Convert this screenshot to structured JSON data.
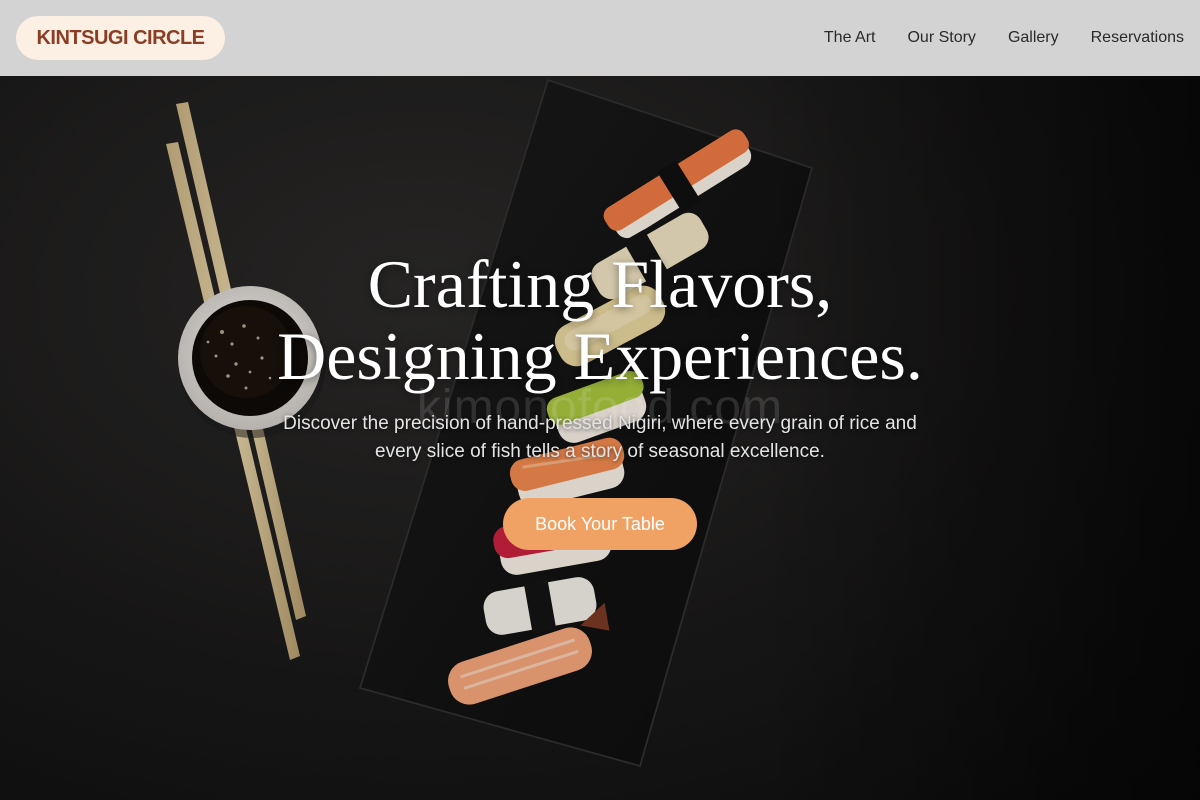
{
  "header": {
    "logo": "KINTSUGI CIRCLE",
    "nav": [
      {
        "label": "The Art"
      },
      {
        "label": "Our Story"
      },
      {
        "label": "Gallery"
      },
      {
        "label": "Reservations"
      }
    ]
  },
  "hero": {
    "title_line1": "Crafting Flavors,",
    "title_line2": "Designing Experiences.",
    "subtitle_line1": "Discover the precision of hand-pressed Nigiri, where every grain of rice and",
    "subtitle_line2": "every slice of fish tells a story of seasonal excellence.",
    "cta_label": "Book Your Table",
    "watermark": "kimonofood.com"
  },
  "colors": {
    "nav_bg": "#d3d3d3",
    "logo_bg": "#fcefe3",
    "logo_text": "#8a3f24",
    "cta_bg": "#f0a265"
  }
}
